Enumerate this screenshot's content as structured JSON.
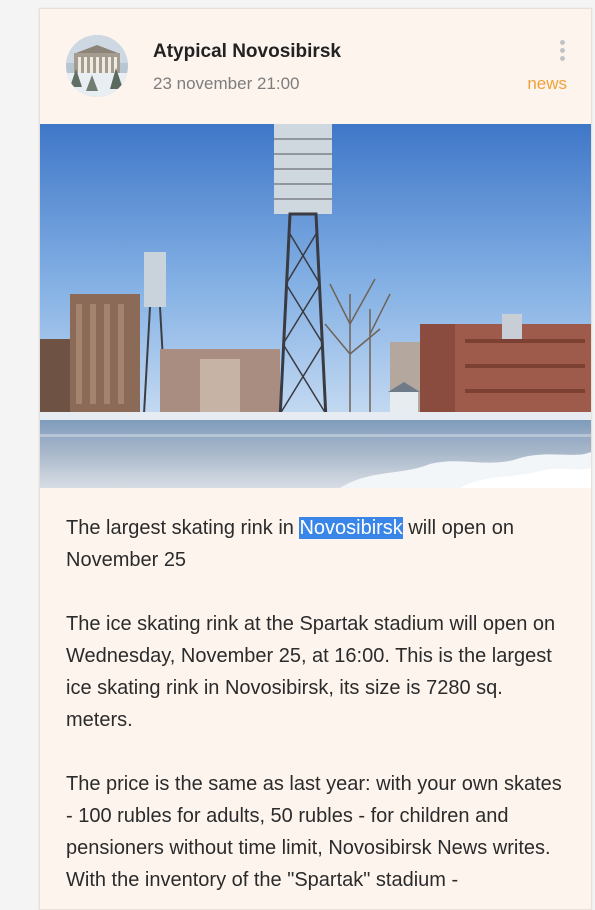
{
  "post": {
    "author": "Atypical Novosibirsk",
    "date": "23 november 21:00",
    "tag": "news",
    "headline_before": "The largest skating rink in ",
    "headline_highlight": "Novosibirsk",
    "headline_after": " will open on November 25",
    "paragraph_2": "The ice skating rink at the Spartak stadium will open on Wednesday, November 25, at 16:00. This is the largest ice skating rink in Novosibirsk, its size is 7280 sq. meters.",
    "paragraph_3": "The price is the same as last year: with your own skates - 100 rubles for adults, 50 rubles - for children and pensioners without time limit, Novosibirsk News writes. With the inventory of the \"Spartak\" stadium -"
  },
  "colors": {
    "card_background": "#fdf4ee",
    "tag_color": "#f0a13a",
    "highlight_color": "#3a86e8"
  },
  "icons": {
    "menu": "more-vertical-icon"
  }
}
